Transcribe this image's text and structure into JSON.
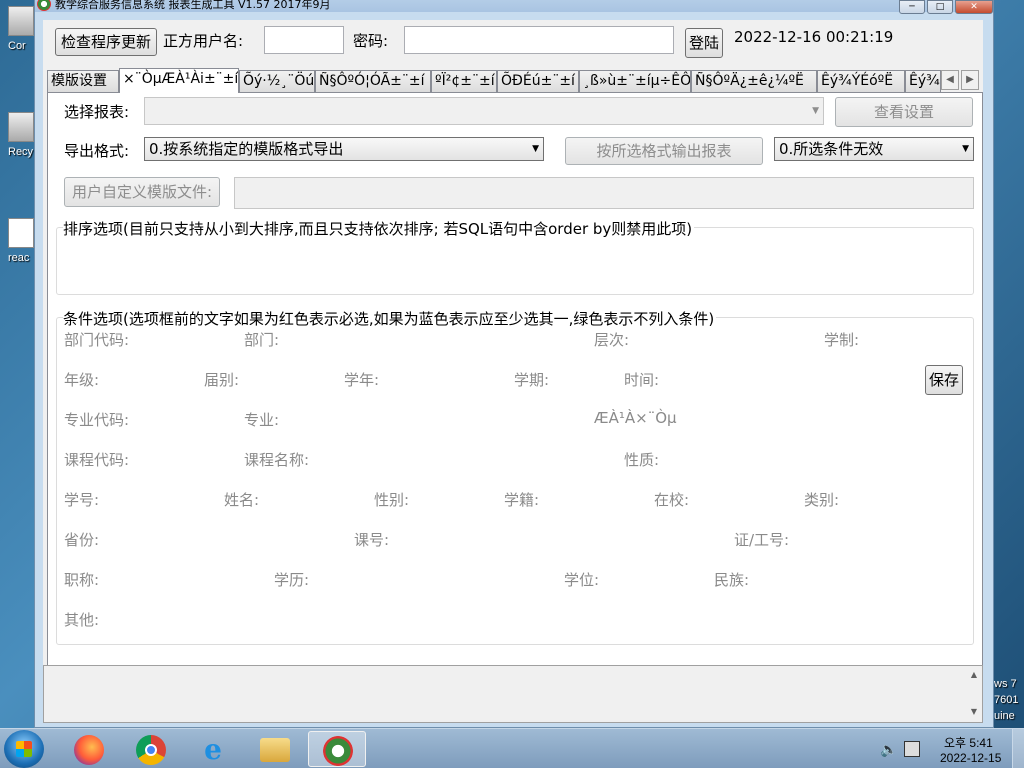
{
  "desktop": {
    "icons": [
      "Cor",
      "Recy",
      "reac"
    ],
    "right_text": [
      "ws 7",
      "7601",
      "uine"
    ]
  },
  "window": {
    "title": "教学综合服务信息系统 报表生成工具 V1.57 2017年9月",
    "min": "─",
    "max": "□",
    "close": "✕"
  },
  "topbar": {
    "check_update": "检查程序更新",
    "username_label": "正方用户名:",
    "username_value": "",
    "password_label": "密码:",
    "password_value": "",
    "login": "登陆",
    "datetime": "2022-12-16 00:21:19"
  },
  "tabs": [
    "模版设置",
    "×¨ÒµÆÀ¹Ài±¨±í",
    "Õý·½¸¨Öú",
    "Ñ§ÔºÓ¦ÓÃ±¨±í",
    "ºÏ²¢±¨±í",
    "ÕÐÉú±¨±í",
    "¸ß»ù±¨±íµ÷ÊÔ",
    "Ñ§ÔºÄ¿±ê¿¼ºË",
    "Êý¾ÝÉóºË",
    "Êý¾"
  ],
  "tab_scroll": {
    "left": "◀",
    "right": "▶"
  },
  "form": {
    "select_report_label": "选择报表:",
    "select_report_value": "",
    "view_settings": "查看设置",
    "export_format_label": "导出格式:",
    "export_format_value": "0.按系统指定的模版格式导出",
    "export_button": "按所选格式输出报表",
    "condition_select": "0.所选条件无效",
    "custom_template_button": "用户自定义模版文件:",
    "custom_template_path": ""
  },
  "sort_group": {
    "title": "排序选项(目前只支持从小到大排序,而且只支持依次排序; 若SQL语句中含order by则禁用此项)"
  },
  "cond_group": {
    "title": "条件选项(选项框前的文字如果为红色表示必选,如果为蓝色表示应至少选其一,绿色表示不列入条件)",
    "save": "保存",
    "fields": {
      "dept_code": "部门代码:",
      "dept": "部门:",
      "level": "层次:",
      "schooling": "学制:",
      "grade": "年级:",
      "session": "届别:",
      "school_year": "学年:",
      "term": "学期:",
      "time": "时间:",
      "major_code": "专业代码:",
      "major": "专业:",
      "garbled": "ÆÀ¹À×¨Òµ",
      "course_code": "课程代码:",
      "course_name": "课程名称:",
      "nature": "性质:",
      "student_id": "学号:",
      "name": "姓名:",
      "gender": "性别:",
      "status": "学籍:",
      "in_school": "在校:",
      "category": "类别:",
      "province": "省份:",
      "class_no": "课号:",
      "id_no": "证/工号:",
      "title_rank": "职称:",
      "education": "学历:",
      "degree": "学位:",
      "ethnicity": "民族:",
      "other": "其他:"
    }
  },
  "taskbar": {
    "clock_time": "오후 5:41",
    "clock_date": "2022-12-15"
  },
  "colors": {
    "window_frame": "#c7dcef",
    "client_bg": "#f0f0f0",
    "disabled_text": "#8a8a8a",
    "taskbar": "#8fabc8"
  }
}
